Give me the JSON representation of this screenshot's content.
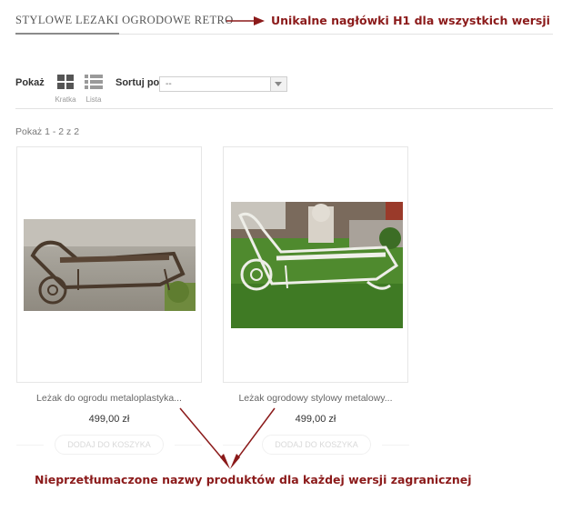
{
  "header": {
    "title": "STYLOWE LEZAKI OGRODOWE RETRO"
  },
  "annotations": {
    "top": "Unikalne nagłówki H1 dla wszystkich wersji",
    "bottom": "Nieprzetłumaczone nazwy produktów dla każdej wersji zagranicznej",
    "color": "#8b1a1a"
  },
  "toolbar": {
    "show_label": "Pokaż",
    "grid_label": "Kratka",
    "list_label": "Lista",
    "sort_label": "Sortuj po",
    "sort_value": "--"
  },
  "results": {
    "count_text": "Pokaż 1 - 2 z 2"
  },
  "products": [
    {
      "name": "Leżak do ogrodu metaloplastyka...",
      "price": "499,00 zł",
      "cart_label": "DODAJ DO KOSZYKA",
      "image_icon": "wrought-iron-lounger-image"
    },
    {
      "name": "Leżak ogrodowy stylowy metalowy...",
      "price": "499,00 zł",
      "cart_label": "DODAJ DO KOSZYKA",
      "image_icon": "white-iron-lounger-image"
    }
  ]
}
